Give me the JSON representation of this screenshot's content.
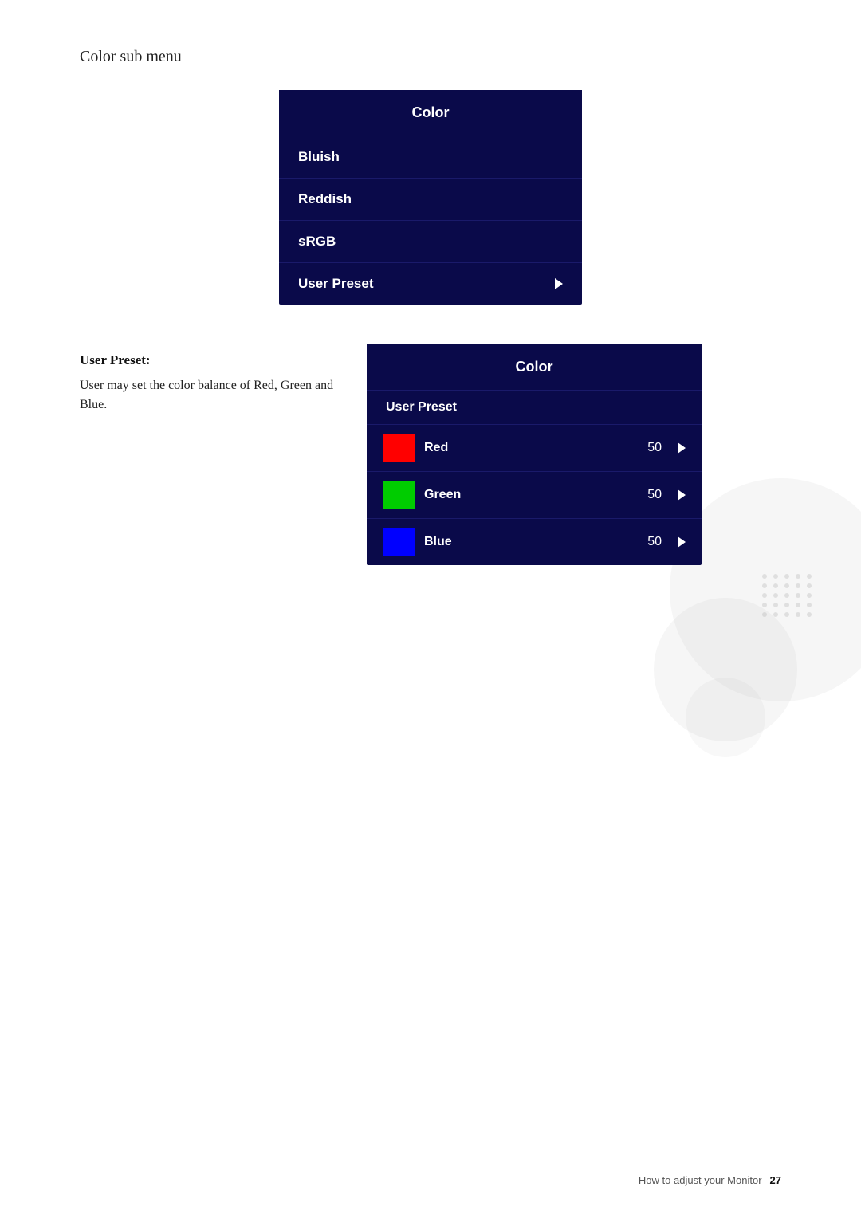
{
  "page": {
    "section_title": "Color sub menu",
    "footer_text": "How to adjust your Monitor",
    "footer_page": "27"
  },
  "color_menu": {
    "title": "Color",
    "items": [
      {
        "label": "Bluish",
        "has_arrow": false
      },
      {
        "label": "Reddish",
        "has_arrow": false
      },
      {
        "label": "sRGB",
        "has_arrow": false
      },
      {
        "label": "User Preset",
        "has_arrow": true
      }
    ]
  },
  "user_preset_section": {
    "description_label": "User Preset:",
    "description_body": "User may set the color balance of Red, Green and Blue.",
    "menu_title": "Color",
    "preset_label": "User Preset",
    "color_rows": [
      {
        "name": "Red",
        "value": "50",
        "color": "#ff0000"
      },
      {
        "name": "Green",
        "value": "50",
        "color": "#00cc00"
      },
      {
        "name": "Blue",
        "value": "50",
        "color": "#0000ff"
      }
    ]
  }
}
